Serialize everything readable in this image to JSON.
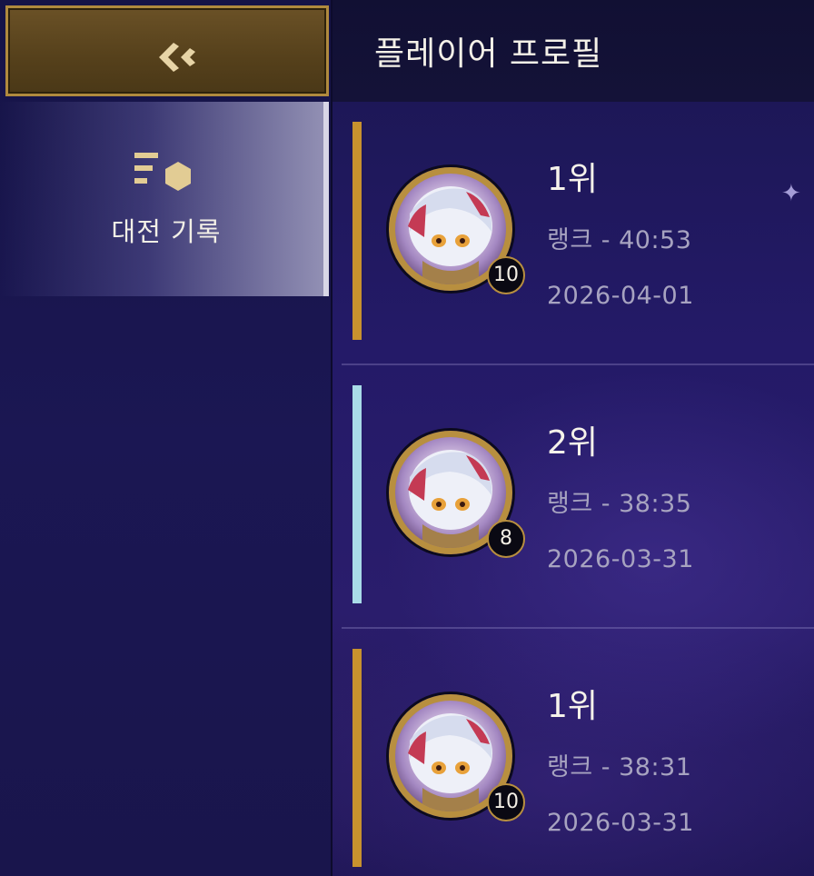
{
  "header": {
    "title": "플레이어 프로필"
  },
  "back_button": {
    "icon": "chevron-double-left-icon"
  },
  "sidebar": {
    "items": [
      {
        "label": "대전 기록",
        "icon": "match-history-icon",
        "active": true
      }
    ]
  },
  "colors": {
    "gold_accent": "#b08a3e",
    "first_place": "#c8922e",
    "second_place": "#a9dbe8"
  },
  "matches": [
    {
      "placement": "1위",
      "mode_duration": "랭크 - 40:53",
      "date": "2026-04-01",
      "level": "10",
      "placement_color": "#c8922e"
    },
    {
      "placement": "2위",
      "mode_duration": "랭크 - 38:35",
      "date": "2026-03-31",
      "level": "8",
      "placement_color": "#a9dbe8"
    },
    {
      "placement": "1위",
      "mode_duration": "랭크 - 38:31",
      "date": "2026-03-31",
      "level": "10",
      "placement_color": "#c8922e"
    }
  ]
}
